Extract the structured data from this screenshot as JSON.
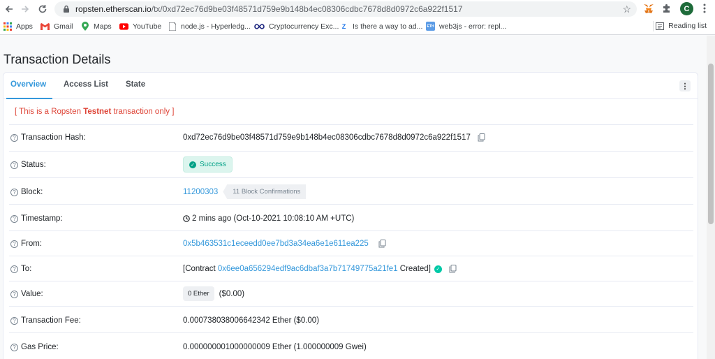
{
  "browser": {
    "url_host": "ropsten.etherscan.io",
    "url_path": "/tx/0xd72ec76d9be03f48571d759e9b148b4ec08306cdbc7678d8d0972c6a922f1517",
    "profile_initial": "C"
  },
  "bookmarks": [
    {
      "label": "Apps",
      "icon": "apps-grid-icon"
    },
    {
      "label": "Gmail",
      "icon": "gmail-icon"
    },
    {
      "label": "Maps",
      "icon": "maps-icon"
    },
    {
      "label": "YouTube",
      "icon": "youtube-icon"
    },
    {
      "label": "node.js - Hyperledg...",
      "icon": "page-icon"
    },
    {
      "label": "Cryptocurrency Exc...",
      "icon": "infinity-icon"
    },
    {
      "label": "Is there a way to ad...",
      "icon": "z-icon"
    },
    {
      "label": "web3js - error: repl...",
      "icon": "eth-icon"
    }
  ],
  "reading_list": "Reading list",
  "page": {
    "title": "Transaction Details",
    "tabs": [
      "Overview",
      "Access List",
      "State"
    ],
    "testnet_prefix": "[ This is a Ropsten ",
    "testnet_bold": "Testnet",
    "testnet_suffix": " transaction only ]"
  },
  "fields": {
    "hash_label": "Transaction Hash:",
    "hash_value": "0xd72ec76d9be03f48571d759e9b148b4ec08306cdbc7678d8d0972c6a922f1517",
    "status_label": "Status:",
    "status_value": "Success",
    "block_label": "Block:",
    "block_value": "11200303",
    "block_confirmations": "11 Block Confirmations",
    "timestamp_label": "Timestamp:",
    "timestamp_value": "2 mins ago (Oct-10-2021 10:08:10 AM +UTC)",
    "from_label": "From:",
    "from_value": "0x5b463531c1eceedd0ee7bd3a34ea6e1e611ea225",
    "to_label": "To:",
    "to_prefix": "[Contract ",
    "to_value": "0x6ee0a656294edf9ac6dbaf3a7b71749775a21fe1",
    "to_suffix": " Created]",
    "value_label": "Value:",
    "value_ether": "0 Ether",
    "value_usd": "($0.00)",
    "fee_label": "Transaction Fee:",
    "fee_value": "0.000738038006642342 Ether ($0.00)",
    "gas_label": "Gas Price:",
    "gas_value": "0.000000001000000009 Ether (1.000000009 Gwei)"
  },
  "colors": {
    "link": "#3498db",
    "success": "#00a186",
    "testnet": "#de4437"
  }
}
